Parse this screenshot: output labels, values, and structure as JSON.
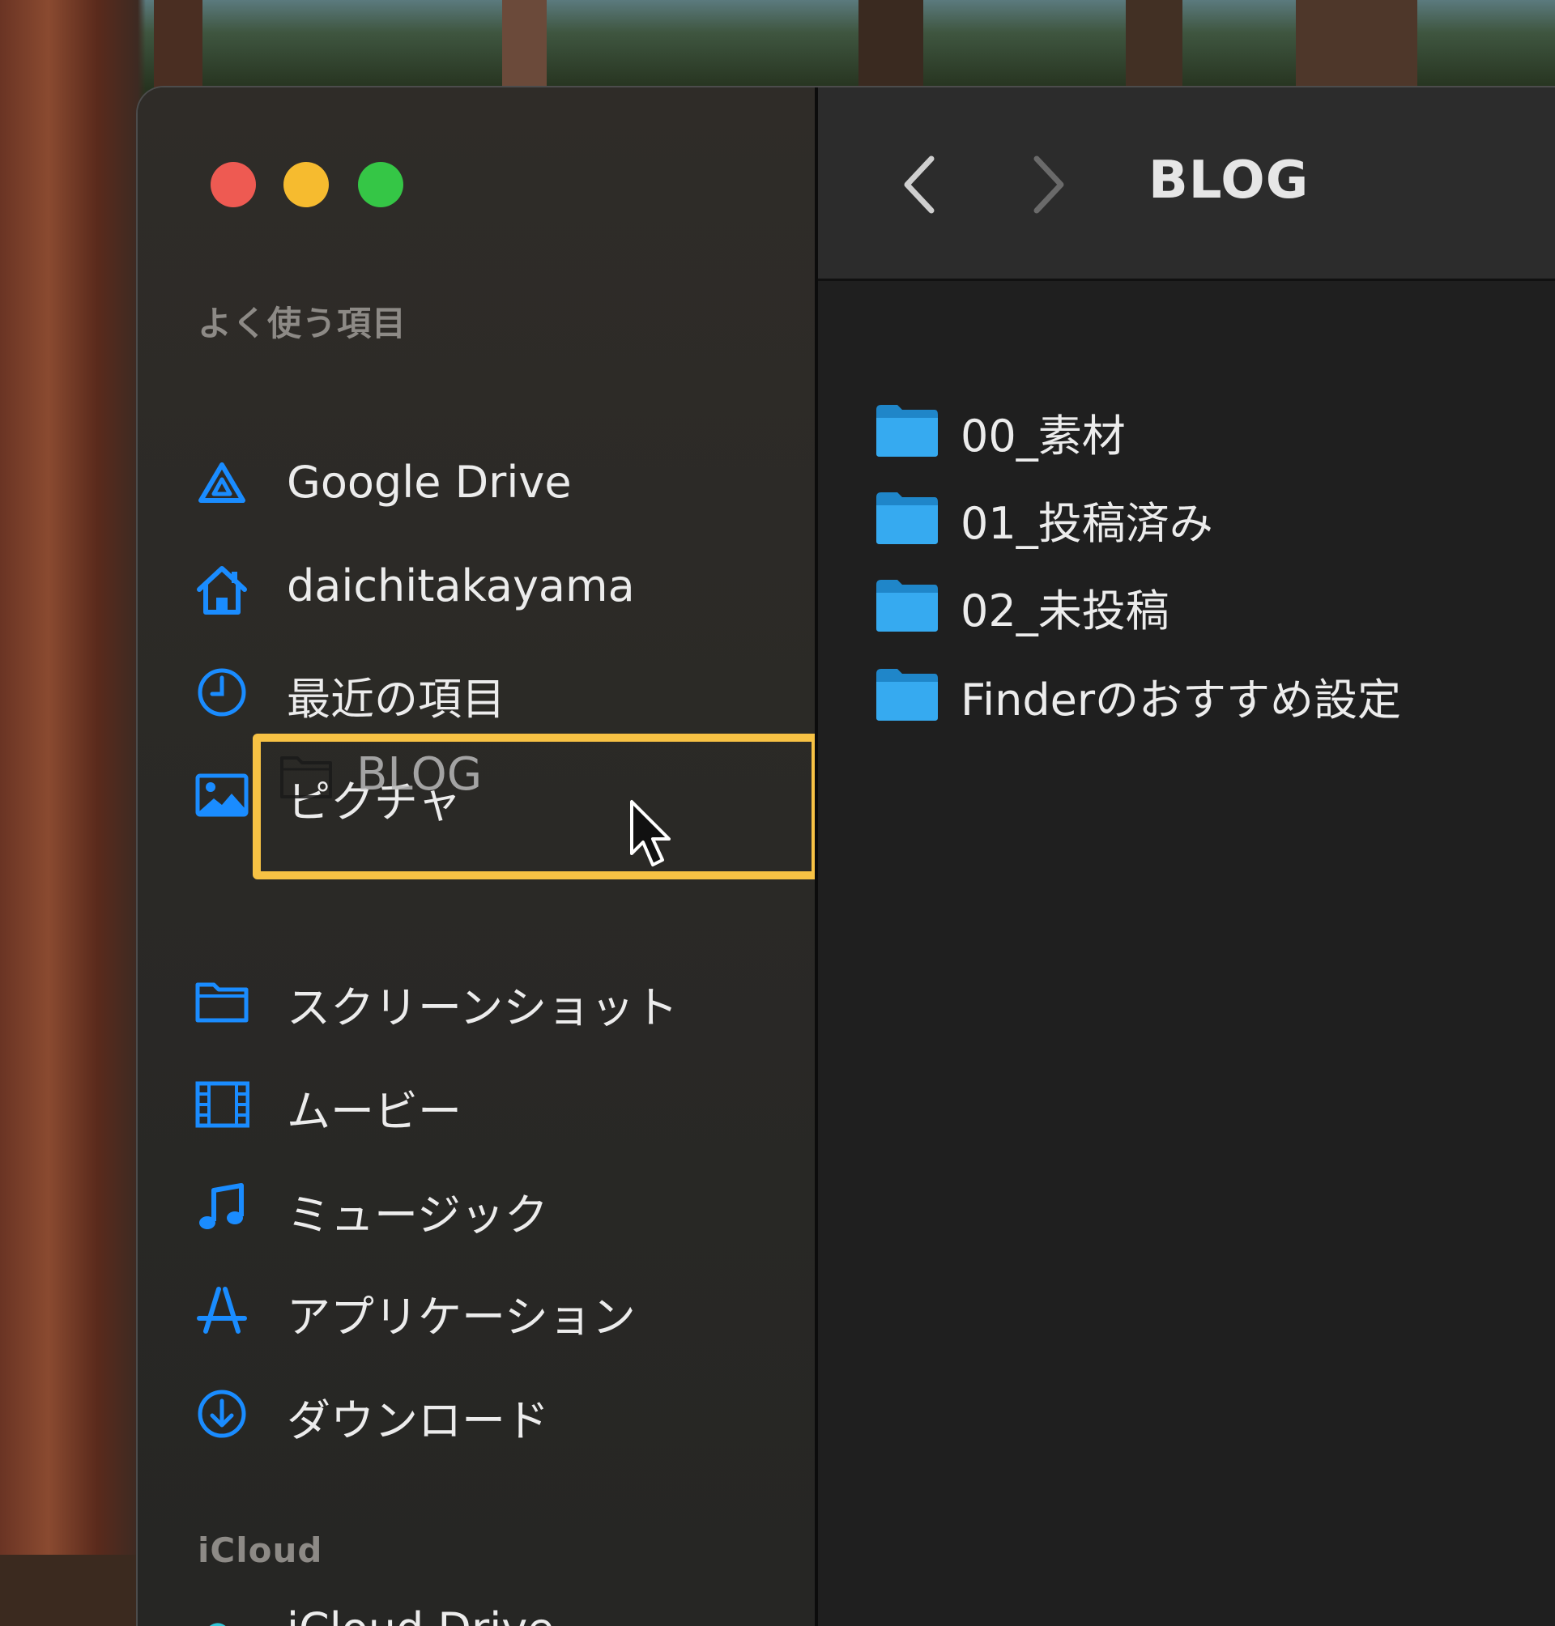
{
  "window": {
    "title": "BLOG"
  },
  "sidebar": {
    "favorites_label": "よく使う項目",
    "items": [
      {
        "label": "Google Drive",
        "icon": "google-drive-icon"
      },
      {
        "label": "daichitakayama",
        "icon": "home-icon"
      },
      {
        "label": "最近の項目",
        "icon": "clock-icon"
      },
      {
        "label": "ピクチャ",
        "icon": "photo-icon"
      },
      {
        "label": "スクリーンショット",
        "icon": "folder-icon"
      },
      {
        "label": "ムービー",
        "icon": "film-icon"
      },
      {
        "label": "ミュージック",
        "icon": "music-note-icon"
      },
      {
        "label": "アプリケーション",
        "icon": "app-store-icon"
      },
      {
        "label": "ダウンロード",
        "icon": "download-icon"
      }
    ],
    "dragging_item": {
      "label": "BLOG",
      "icon": "folder-outline-icon"
    },
    "icloud_label": "iCloud",
    "icloud_items": [
      {
        "label": "iCloud Drive",
        "icon": "cloud-icon"
      }
    ]
  },
  "main": {
    "files": [
      {
        "name": "00_素材",
        "icon": "folder-icon"
      },
      {
        "name": "01_投稿済み",
        "icon": "folder-icon"
      },
      {
        "name": "02_未投稿",
        "icon": "folder-icon"
      },
      {
        "name": "Finderのおすすめ設定",
        "icon": "folder-icon"
      }
    ]
  },
  "colors": {
    "accent": "#1a8cff",
    "highlight": "#f7c244",
    "folder": "#2fa5ea"
  }
}
